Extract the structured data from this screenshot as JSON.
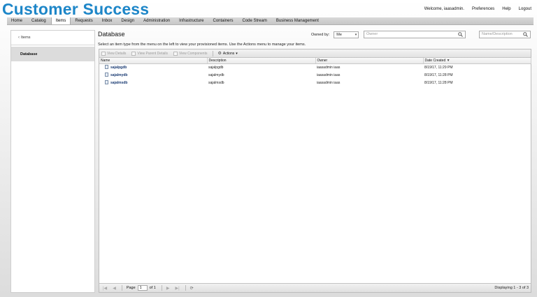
{
  "brand": "Customer Success",
  "userbar": {
    "welcome": "Welcome, iaasadmin.",
    "preferences": "Preferences",
    "help": "Help",
    "logout": "Logout"
  },
  "nav": {
    "tabs": [
      "Home",
      "Catalog",
      "Items",
      "Requests",
      "Inbox",
      "Design",
      "Administration",
      "Infrastructure",
      "Containers",
      "Code Stream",
      "Business Management"
    ],
    "active": "Items"
  },
  "sidebar": {
    "back_label": "Items",
    "selected_item": "Database"
  },
  "main": {
    "title": "Database",
    "owned_by_label": "Owned by:",
    "owned_by_value": "Me",
    "owner_placeholder": "Owner",
    "name_placeholder": "Name/Description",
    "hint": "Select an item type from the menu on the left to view your provisioned items. Use the Actions menu to manage your items."
  },
  "toolbar": {
    "view_details": "View Details",
    "view_parent_details": "View Parent Details",
    "view_components": "View Components",
    "actions": "Actions"
  },
  "table": {
    "columns": [
      "Name",
      "Description",
      "Owner",
      "Date Created"
    ],
    "rows": [
      {
        "name": "sajalpgdb",
        "description": "sajalpgdb",
        "owner": "iaasadmin iaas",
        "date": "8/19/17, 11:29 PM"
      },
      {
        "name": "sajalmydb",
        "description": "sajalmydb",
        "owner": "iaasadmin iaas",
        "date": "8/19/17, 11:28 PM"
      },
      {
        "name": "sajalmsdb",
        "description": "sajalmsdb",
        "owner": "iaasadmin iaas",
        "date": "8/19/17, 11:28 PM"
      }
    ]
  },
  "pager": {
    "page_label": "Page",
    "page_value": "1",
    "of_label": "of 1",
    "display": "Displaying 1 - 3 of 3"
  }
}
